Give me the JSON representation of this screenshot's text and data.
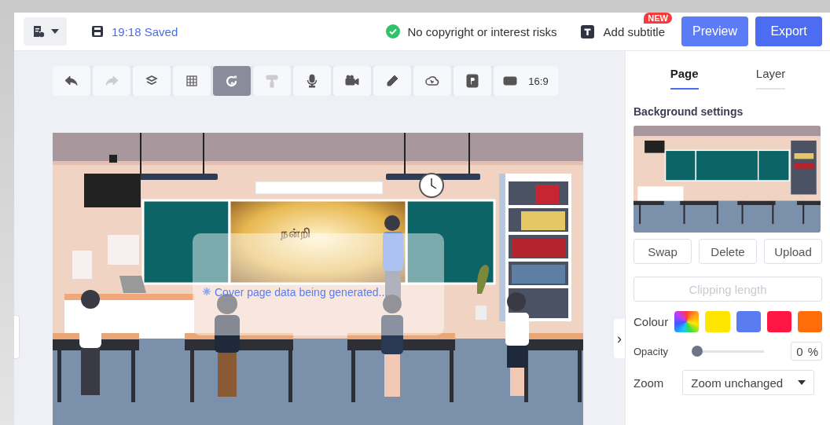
{
  "header": {
    "save_status": "19:18 Saved",
    "copyright_status": "No copyright or interest risks",
    "subtitle_button": {
      "label": "Add subtitle",
      "badge": "NEW"
    },
    "buttons": [
      "Preview",
      "Export"
    ]
  },
  "toolbar": {
    "items": [
      {
        "selected": false,
        "disabled": false
      },
      {
        "selected": false,
        "disabled": true
      },
      {
        "selected": false,
        "disabled": false
      },
      {
        "selected": false,
        "disabled": false
      },
      {
        "selected": true,
        "disabled": false
      },
      {
        "selected": false,
        "disabled": true
      },
      {
        "selected": false,
        "disabled": false
      },
      {
        "selected": false,
        "disabled": false
      },
      {
        "selected": false,
        "disabled": false
      },
      {
        "selected": false,
        "disabled": false
      },
      {
        "selected": false,
        "disabled": false
      },
      {
        "selected": false,
        "disabled": false
      }
    ],
    "aspect_ratio": "16:9"
  },
  "canvas": {
    "slide_text": "நன்றி",
    "loading_message": "Cover page data being generated..."
  },
  "panel": {
    "tabs": [
      {
        "label": "Page",
        "selected": true
      },
      {
        "label": "Layer",
        "selected": false
      }
    ],
    "section_title": "Background settings",
    "background_actions": [
      "Swap",
      "Delete",
      "Upload"
    ],
    "clipping_button": {
      "label": "Clipping length",
      "disabled": true
    },
    "colour": {
      "label": "Colour",
      "swatches": [
        {
          "kind": "gradient"
        },
        {
          "kind": "solid",
          "color": "#ffe600"
        },
        {
          "kind": "solid",
          "color": "#5b7cf0"
        },
        {
          "kind": "solid",
          "color": "#ff1744"
        },
        {
          "kind": "solid",
          "color": "#ff6d0a"
        }
      ]
    },
    "opacity": {
      "label": "Opacity",
      "level": 0,
      "value": "0",
      "unit": "%"
    },
    "zoom": {
      "label": "Zoom",
      "value": "Zoom unchanged"
    }
  },
  "panel_toggle": "›"
}
